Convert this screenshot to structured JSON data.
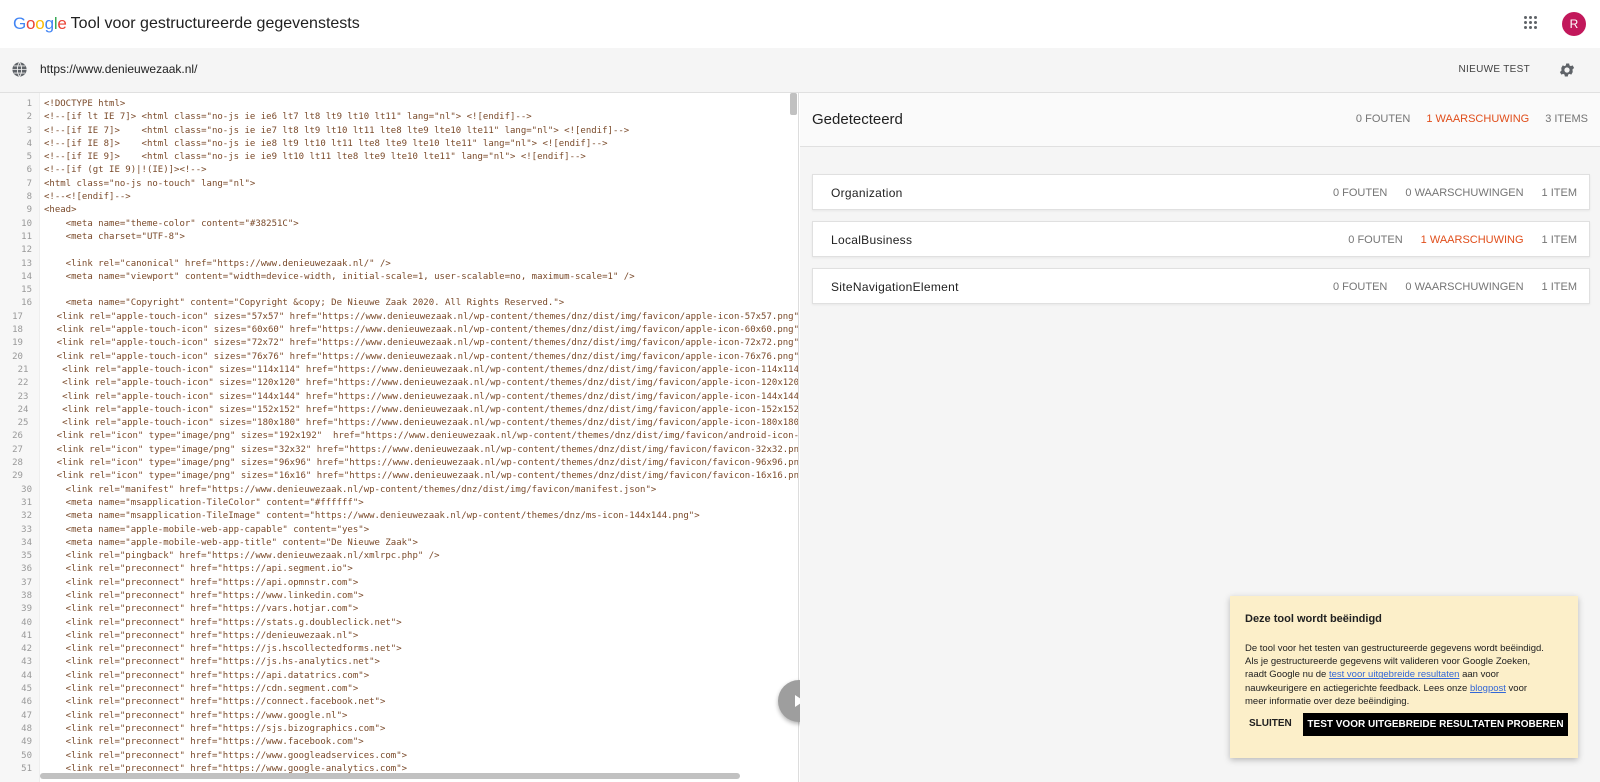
{
  "header": {
    "logo": [
      "G",
      "o",
      "o",
      "g",
      "l",
      "e"
    ],
    "logo_colors": [
      "#4285F4",
      "#EA4335",
      "#FBBC05",
      "#4285F4",
      "#34A853",
      "#EA4335"
    ],
    "title": "Tool voor gestructureerde gegevenstests",
    "avatar_initial": "R",
    "avatar_color": "#c2185b"
  },
  "urlbar": {
    "url": "https://www.denieuwezaak.nl/",
    "new_test_label": "NIEUWE TEST"
  },
  "code_lines": [
    "<!DOCTYPE html>",
    "<!--[if lt IE 7]> <html class=\"no-js ie ie6 lt7 lt8 lt9 lt10 lt11\" lang=\"nl\"> <![endif]-->",
    "<!--[if IE 7]>    <html class=\"no-js ie ie7 lt8 lt9 lt10 lt11 lte8 lte9 lte10 lte11\" lang=\"nl\"> <![endif]-->",
    "<!--[if IE 8]>    <html class=\"no-js ie ie8 lt9 lt10 lt11 lte8 lte9 lte10 lte11\" lang=\"nl\"> <![endif]-->",
    "<!--[if IE 9]>    <html class=\"no-js ie ie9 lt10 lt11 lte8 lte9 lte10 lte11\" lang=\"nl\"> <![endif]-->",
    "<!--[if (gt IE 9)|!(IE)]><!-->",
    "<html class=\"no-js no-touch\" lang=\"nl\">",
    "<!--<![endif]-->",
    "<head>",
    "    <meta name=\"theme-color\" content=\"#38251C\">",
    "    <meta charset=\"UTF-8\">",
    "",
    "    <link rel=\"canonical\" href=\"https://www.denieuwezaak.nl/\" />",
    "    <meta name=\"viewport\" content=\"width=device-width, initial-scale=1, user-scalable=no, maximum-scale=1\" />",
    "",
    "    <meta name=\"Copyright\" content=\"Copyright &copy; De Nieuwe Zaak 2020. All Rights Reserved.\">",
    "    <link rel=\"apple-touch-icon\" sizes=\"57x57\" href=\"https://www.denieuwezaak.nl/wp-content/themes/dnz/dist/img/favicon/apple-icon-57x57.png\"",
    "    <link rel=\"apple-touch-icon\" sizes=\"60x60\" href=\"https://www.denieuwezaak.nl/wp-content/themes/dnz/dist/img/favicon/apple-icon-60x60.png\"",
    "    <link rel=\"apple-touch-icon\" sizes=\"72x72\" href=\"https://www.denieuwezaak.nl/wp-content/themes/dnz/dist/img/favicon/apple-icon-72x72.png\"",
    "    <link rel=\"apple-touch-icon\" sizes=\"76x76\" href=\"https://www.denieuwezaak.nl/wp-content/themes/dnz/dist/img/favicon/apple-icon-76x76.png\"",
    "    <link rel=\"apple-touch-icon\" sizes=\"114x114\" href=\"https://www.denieuwezaak.nl/wp-content/themes/dnz/dist/img/favicon/apple-icon-114x114",
    "    <link rel=\"apple-touch-icon\" sizes=\"120x120\" href=\"https://www.denieuwezaak.nl/wp-content/themes/dnz/dist/img/favicon/apple-icon-120x120",
    "    <link rel=\"apple-touch-icon\" sizes=\"144x144\" href=\"https://www.denieuwezaak.nl/wp-content/themes/dnz/dist/img/favicon/apple-icon-144x144",
    "    <link rel=\"apple-touch-icon\" sizes=\"152x152\" href=\"https://www.denieuwezaak.nl/wp-content/themes/dnz/dist/img/favicon/apple-icon-152x152",
    "    <link rel=\"apple-touch-icon\" sizes=\"180x180\" href=\"https://www.denieuwezaak.nl/wp-content/themes/dnz/dist/img/favicon/apple-icon-180x180",
    "    <link rel=\"icon\" type=\"image/png\" sizes=\"192x192\"  href=\"https://www.denieuwezaak.nl/wp-content/themes/dnz/dist/img/favicon/android-icon-",
    "    <link rel=\"icon\" type=\"image/png\" sizes=\"32x32\" href=\"https://www.denieuwezaak.nl/wp-content/themes/dnz/dist/img/favicon/favicon-32x32.pn",
    "    <link rel=\"icon\" type=\"image/png\" sizes=\"96x96\" href=\"https://www.denieuwezaak.nl/wp-content/themes/dnz/dist/img/favicon/favicon-96x96.pn",
    "    <link rel=\"icon\" type=\"image/png\" sizes=\"16x16\" href=\"https://www.denieuwezaak.nl/wp-content/themes/dnz/dist/img/favicon/favicon-16x16.pn",
    "    <link rel=\"manifest\" href=\"https://www.denieuwezaak.nl/wp-content/themes/dnz/dist/img/favicon/manifest.json\">",
    "    <meta name=\"msapplication-TileColor\" content=\"#ffffff\">",
    "    <meta name=\"msapplication-TileImage\" content=\"https://www.denieuwezaak.nl/wp-content/themes/dnz/ms-icon-144x144.png\">",
    "    <meta name=\"apple-mobile-web-app-capable\" content=\"yes\">",
    "    <meta name=\"apple-mobile-web-app-title\" content=\"De Nieuwe Zaak\">",
    "    <link rel=\"pingback\" href=\"https://www.denieuwezaak.nl/xmlrpc.php\" />",
    "    <link rel=\"preconnect\" href=\"https://api.segment.io\">",
    "    <link rel=\"preconnect\" href=\"https://api.opmnstr.com\">",
    "    <link rel=\"preconnect\" href=\"https://www.linkedin.com\">",
    "    <link rel=\"preconnect\" href=\"https://vars.hotjar.com\">",
    "    <link rel=\"preconnect\" href=\"https://stats.g.doubleclick.net\">",
    "    <link rel=\"preconnect\" href=\"https://denieuwezaak.nl\">",
    "    <link rel=\"preconnect\" href=\"https://js.hscollectedforms.net\">",
    "    <link rel=\"preconnect\" href=\"https://js.hs-analytics.net\">",
    "    <link rel=\"preconnect\" href=\"https://api.datatrics.com\">",
    "    <link rel=\"preconnect\" href=\"https://cdn.segment.com\">",
    "    <link rel=\"preconnect\" href=\"https://connect.facebook.net\">",
    "    <link rel=\"preconnect\" href=\"https://www.google.nl\">",
    "    <link rel=\"preconnect\" href=\"https://sjs.bizographics.com\">",
    "    <link rel=\"preconnect\" href=\"https://www.facebook.com\">",
    "    <link rel=\"preconnect\" href=\"https://www.googleadservices.com\">",
    "    <link rel=\"preconnect\" href=\"https://www.google-analytics.com\">"
  ],
  "results": {
    "title": "Gedetecteerd",
    "errors": "0 FOUTEN",
    "warnings": "1 WAARSCHUWING",
    "items": "3 ITEMS",
    "warning_color": "#e04e1b",
    "cards": [
      {
        "name": "Organization",
        "errors": "0 FOUTEN",
        "warnings": "0 WAARSCHUWINGEN",
        "items": "1 ITEM",
        "has_warning": false
      },
      {
        "name": "LocalBusiness",
        "errors": "0 FOUTEN",
        "warnings": "1 WAARSCHUWING",
        "items": "1 ITEM",
        "has_warning": true
      },
      {
        "name": "SiteNavigationElement",
        "errors": "0 FOUTEN",
        "warnings": "0 WAARSCHUWINGEN",
        "items": "1 ITEM",
        "has_warning": false
      }
    ]
  },
  "notice": {
    "title": "Deze tool wordt beëindigd",
    "body_1": "De tool voor het testen van gestructureerde gegevens wordt beëindigd. Als je gestructureerde gegevens wilt valideren voor Google Zoeken, raadt Google nu de ",
    "link_1": "test voor uitgebreide resultaten",
    "body_2": " aan voor nauwkeurigere en actiegerichte feedback. Lees onze ",
    "link_2": "blogpost",
    "body_3": " voor meer informatie over deze beëindiging.",
    "close_label": "SLUITEN",
    "try_label": "TEST VOOR UITGEBREIDE RESULTATEN PROBEREN"
  }
}
